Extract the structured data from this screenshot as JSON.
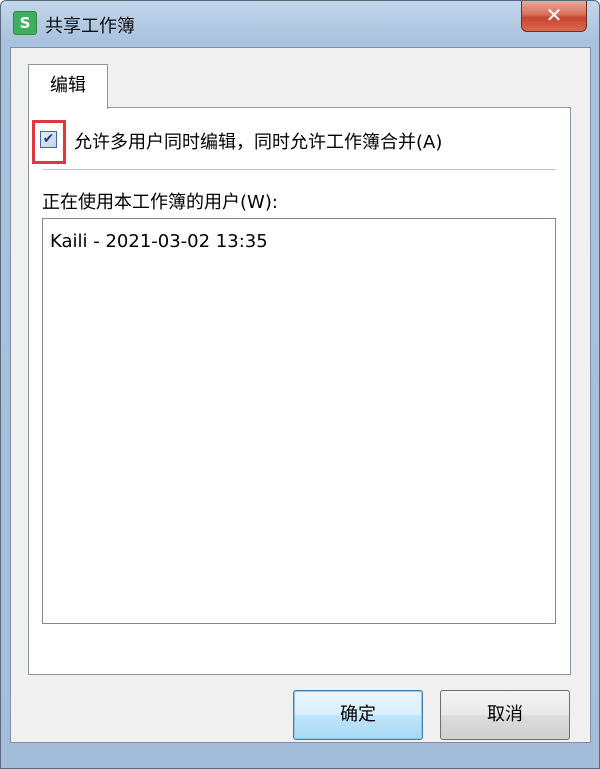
{
  "window": {
    "title": "共享工作簿",
    "app_icon_letter": "S",
    "close_symbol": "✕"
  },
  "tabs": [
    {
      "label": "编辑",
      "active": true
    }
  ],
  "edit_tab": {
    "allow_multiuser_label": "允许多用户同时编辑，同时允许工作簿合并(A)",
    "allow_multiuser_checked": true,
    "check_mark": "✔",
    "users_label": "正在使用本工作簿的用户(W):",
    "users": [
      "Kaili - 2021-03-02 13:35"
    ]
  },
  "buttons": {
    "ok_label": "确定",
    "cancel_label": "取消"
  },
  "colors": {
    "highlight": "#e0373e",
    "app_icon": "#3fae5f",
    "close_button": "#c7452e"
  }
}
